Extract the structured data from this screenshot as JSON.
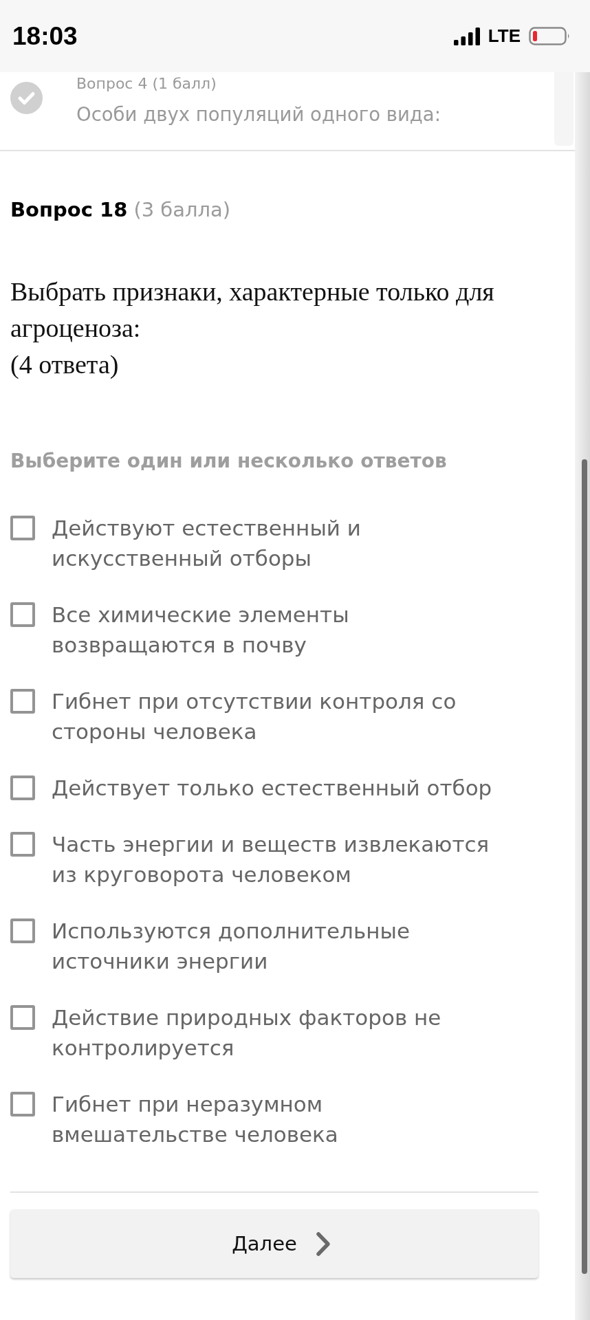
{
  "status_bar": {
    "time": "18:03",
    "network": "LTE"
  },
  "previous_question": {
    "title": "Вопрос 4 (1 балл)",
    "text": "Особи двух популяций одного вида:",
    "answered": true
  },
  "question": {
    "number": "Вопрос 18",
    "points": "(3 балла)",
    "text": [
      "Выбрать признаки, характерные только для агроценоза:",
      "(4 ответа)"
    ],
    "instruction": "Выберите один или несколько ответов",
    "options": [
      {
        "label": "Действуют естественный и искусственный отборы",
        "checked": false
      },
      {
        "label": "Все химические элементы возвращаются в почву",
        "checked": false
      },
      {
        "label": "Гибнет при отсутствии контроля со стороны человека",
        "checked": false
      },
      {
        "label": "Действует только естественный отбор",
        "checked": false
      },
      {
        "label": "Часть энергии и веществ извлекаются из круговорота человеком",
        "checked": false
      },
      {
        "label": "Используются дополнительные источники энергии",
        "checked": false
      },
      {
        "label": "Действие природных факторов не контролируется",
        "checked": false
      },
      {
        "label": "Гибнет при неразумном вмешательстве человека",
        "checked": false
      }
    ]
  },
  "next_button": {
    "label": "Далее"
  }
}
